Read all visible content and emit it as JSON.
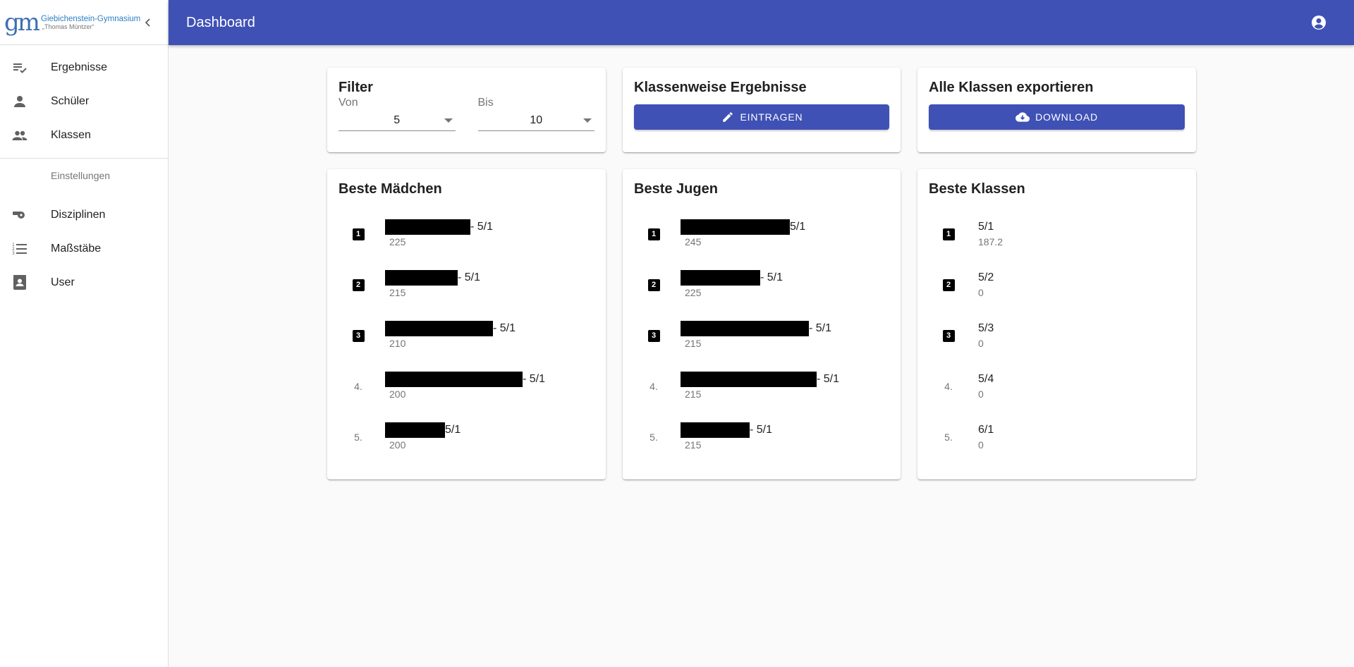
{
  "brand": {
    "name": "Giebichenstein-Gymnasium",
    "sub": "„Thomas Müntzer“",
    "mark": "gm"
  },
  "sidebar": {
    "items": [
      {
        "label": "Ergebnisse",
        "icon": "playlist-check-icon"
      },
      {
        "label": "Schüler",
        "icon": "person-icon"
      },
      {
        "label": "Klassen",
        "icon": "people-icon"
      }
    ],
    "settings_header": "Einstellungen",
    "settings_items": [
      {
        "label": "Disziplinen",
        "icon": "whistle-icon"
      },
      {
        "label": "Maßstäbe",
        "icon": "format-list-numbered-icon"
      },
      {
        "label": "User",
        "icon": "contact-card-icon"
      }
    ]
  },
  "header": {
    "title": "Dashboard"
  },
  "filter": {
    "title": "Filter",
    "from_label": "Von",
    "from_value": "5",
    "to_label": "Bis",
    "to_value": "10"
  },
  "class_results": {
    "title": "Klassenweise Ergebnisse",
    "button_label": "EINTRAGEN"
  },
  "export": {
    "title": "Alle Klassen exportieren",
    "button_label": "DOWNLOAD"
  },
  "best_girls": {
    "title": "Beste Mädchen",
    "entries": [
      {
        "rank": "1",
        "suffix": "- 5/1",
        "score": "225"
      },
      {
        "rank": "2",
        "suffix": "- 5/1",
        "score": "215"
      },
      {
        "rank": "3",
        "suffix": "- 5/1",
        "score": "210"
      },
      {
        "rank": "4.",
        "suffix": "- 5/1",
        "score": "200"
      },
      {
        "rank": "5.",
        "suffix": "5/1",
        "score": "200"
      }
    ]
  },
  "best_boys": {
    "title": "Beste Jugen",
    "entries": [
      {
        "rank": "1",
        "suffix": "5/1",
        "score": "245"
      },
      {
        "rank": "2",
        "suffix": "- 5/1",
        "score": "225"
      },
      {
        "rank": "3",
        "suffix": "- 5/1",
        "score": "215"
      },
      {
        "rank": "4.",
        "suffix": "- 5/1",
        "score": "215"
      },
      {
        "rank": "5.",
        "suffix": "- 5/1",
        "score": "215"
      }
    ]
  },
  "best_classes": {
    "title": "Beste Klassen",
    "entries": [
      {
        "rank": "1",
        "name": "5/1",
        "score": "187.2"
      },
      {
        "rank": "2",
        "name": "5/2",
        "score": "0"
      },
      {
        "rank": "3",
        "name": "5/3",
        "score": "0"
      },
      {
        "rank": "4.",
        "name": "5/4",
        "score": "0"
      },
      {
        "rank": "5.",
        "name": "6/1",
        "score": "0"
      }
    ]
  },
  "colors": {
    "primary": "#3f51b5",
    "background": "#fafafa"
  }
}
